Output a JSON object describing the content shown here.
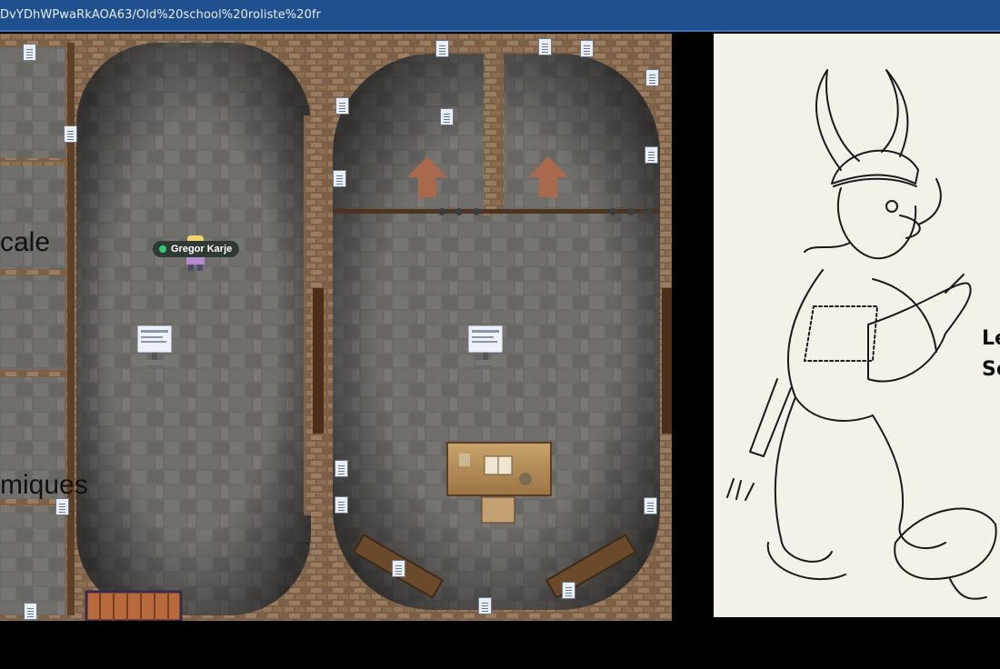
{
  "browser": {
    "url": "DvYDhWPwaRkAOA63/Old%20school%20roliste%20fr"
  },
  "map": {
    "labels": [
      "cale",
      "miques"
    ],
    "player": {
      "name": "Gregor Karje",
      "status_color": "#2ecc71"
    },
    "icons": {
      "note": "document-note-icon",
      "screen": "info-screen-icon",
      "arrow": "up-arrow-icon",
      "desk": "study-desk-object",
      "door": "wooden-door-object"
    }
  },
  "artwork": {
    "description_icon": "viking-warrior-sketch",
    "side_text": [
      "Le",
      "Sc"
    ]
  },
  "colors": {
    "browser_bar": "#1f4f8c",
    "floor": "#6b6a68",
    "wall": "#8a6e4f",
    "arrow": "#a9694d",
    "paper": "#f4f1e9"
  }
}
